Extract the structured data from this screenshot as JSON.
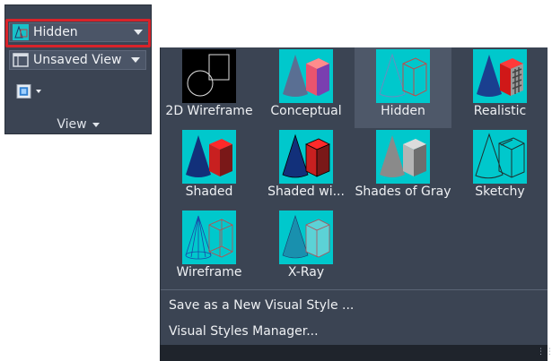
{
  "ribbon_panel": {
    "visual_style_dropdown": {
      "selected": "Hidden"
    },
    "named_view_dropdown": {
      "selected": "Unsaved View"
    },
    "panel_title": "View"
  },
  "gallery": {
    "selected": "Hidden",
    "styles": [
      {
        "label": "2D Wireframe"
      },
      {
        "label": "Conceptual"
      },
      {
        "label": "Hidden"
      },
      {
        "label": "Realistic"
      },
      {
        "label": "Shaded"
      },
      {
        "label": "Shaded wi..."
      },
      {
        "label": "Shades of Gray"
      },
      {
        "label": "Sketchy"
      },
      {
        "label": "Wireframe"
      },
      {
        "label": "X-Ray"
      }
    ]
  },
  "menu": {
    "save_new": "Save as a New Visual Style ...",
    "manager": "Visual Styles Manager..."
  },
  "colors": {
    "panel_bg": "#3b4453",
    "thumbnail_bg": "#00c8cc",
    "highlight": "#d9232a",
    "selected_tile": "#4e5869"
  }
}
